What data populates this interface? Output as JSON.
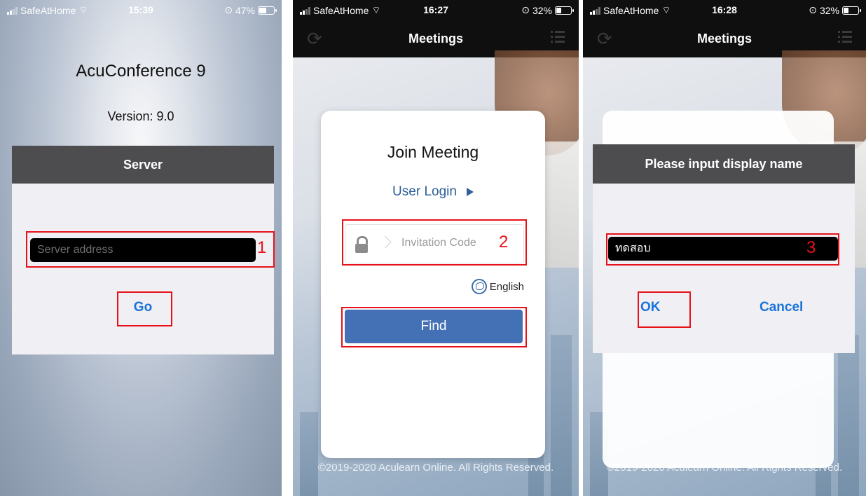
{
  "screens": [
    {
      "status": {
        "carrier": "SafeAtHome",
        "time": "15:39",
        "battery": "47%",
        "battery_level": 0.47
      },
      "app_title": "AcuConference 9",
      "version": "Version: 9.0",
      "server_header": "Server",
      "server_placeholder": "Server address",
      "go_label": "Go",
      "annotation": "1"
    },
    {
      "status": {
        "carrier": "SafeAtHome",
        "time": "16:27",
        "battery": "32%",
        "battery_level": 0.32
      },
      "nav_title": "Meetings",
      "card_title": "Join Meeting",
      "user_login": "User Login",
      "invitation_placeholder": "Invitation Code",
      "language": "English",
      "find_label": "Find",
      "footer": "©2019-2020 Aculearn Online. All Rights Reserved.",
      "annotation": "2"
    },
    {
      "status": {
        "carrier": "SafeAtHome",
        "time": "16:28",
        "battery": "32%",
        "battery_level": 0.32
      },
      "nav_title": "Meetings",
      "dialog_title": "Please input display name",
      "display_name_value": "ทดสอบ",
      "ok_label": "OK",
      "cancel_label": "Cancel",
      "footer": "©2019-2020 Aculearn Online. All Rights Reserved.",
      "annotation": "3"
    }
  ],
  "colors": {
    "annotation": "#e8111a",
    "link": "#1a73d9",
    "find_button": "#4471b6",
    "header": "#4d4c4f"
  }
}
